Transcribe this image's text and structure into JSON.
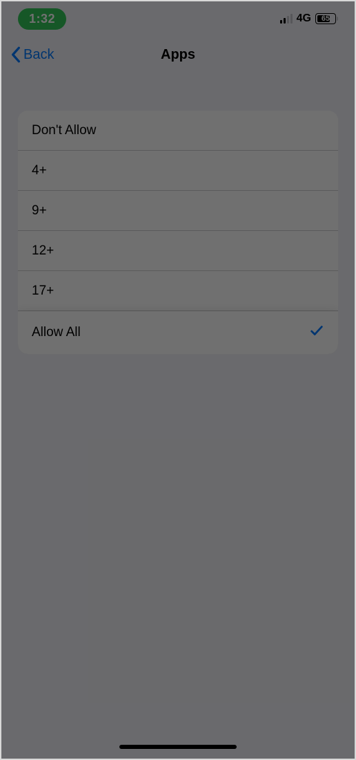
{
  "status_bar": {
    "time": "1:32",
    "network": "4G",
    "battery_text": "65"
  },
  "nav": {
    "back_label": "Back",
    "title": "Apps"
  },
  "options": {
    "items": [
      {
        "label": "Don't Allow",
        "selected": false
      },
      {
        "label": "4+",
        "selected": false
      },
      {
        "label": "9+",
        "selected": false
      },
      {
        "label": "12+",
        "selected": false
      },
      {
        "label": "17+",
        "selected": false
      },
      {
        "label": "Allow All",
        "selected": true
      }
    ]
  },
  "colors": {
    "accent": "#007aff",
    "status_pill": "#34c759",
    "background": "#f2f2f7"
  }
}
